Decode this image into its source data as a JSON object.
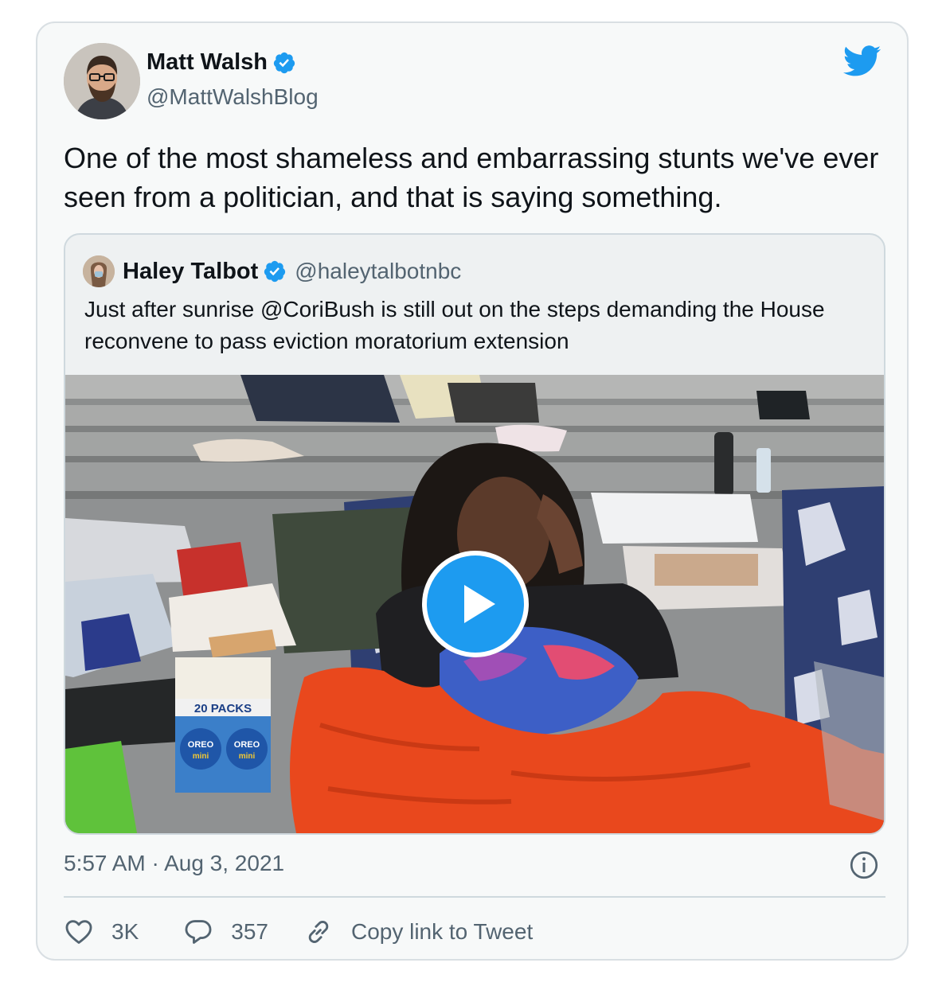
{
  "tweet": {
    "author_name": "Matt Walsh",
    "author_handle": "@MattWalshBlog",
    "verified": true,
    "text": "One of the most shameless and embarrassing stunts we've ever seen from a politician, and that is saying something.",
    "timestamp": "5:57 AM · Aug 3, 2021",
    "likes": "3K",
    "replies": "357",
    "copy_link_label": "Copy link to Tweet"
  },
  "quoted_tweet": {
    "author_name": "Haley Talbot",
    "author_handle": "@haleytalbotnbc",
    "verified": true,
    "text": "Just after sunrise @CoriBush is still out on the steps demanding the House reconvene to pass eviction moratorium extension",
    "media": {
      "type": "video",
      "package_text_1": "20 PACKS",
      "package_text_2": "OREO",
      "package_text_3": "mini"
    }
  },
  "icons": {
    "logo": "twitter-bird-icon",
    "verified": "verified-badge-icon",
    "info": "info-icon",
    "like": "heart-icon",
    "reply": "reply-bubble-icon",
    "copy_link": "link-icon",
    "play": "play-icon"
  },
  "colors": {
    "brand_blue": "#1d9bf0",
    "text_primary": "#0f1419",
    "text_secondary": "#536471",
    "card_background": "#f7f9f9",
    "border": "#cfd9de"
  }
}
